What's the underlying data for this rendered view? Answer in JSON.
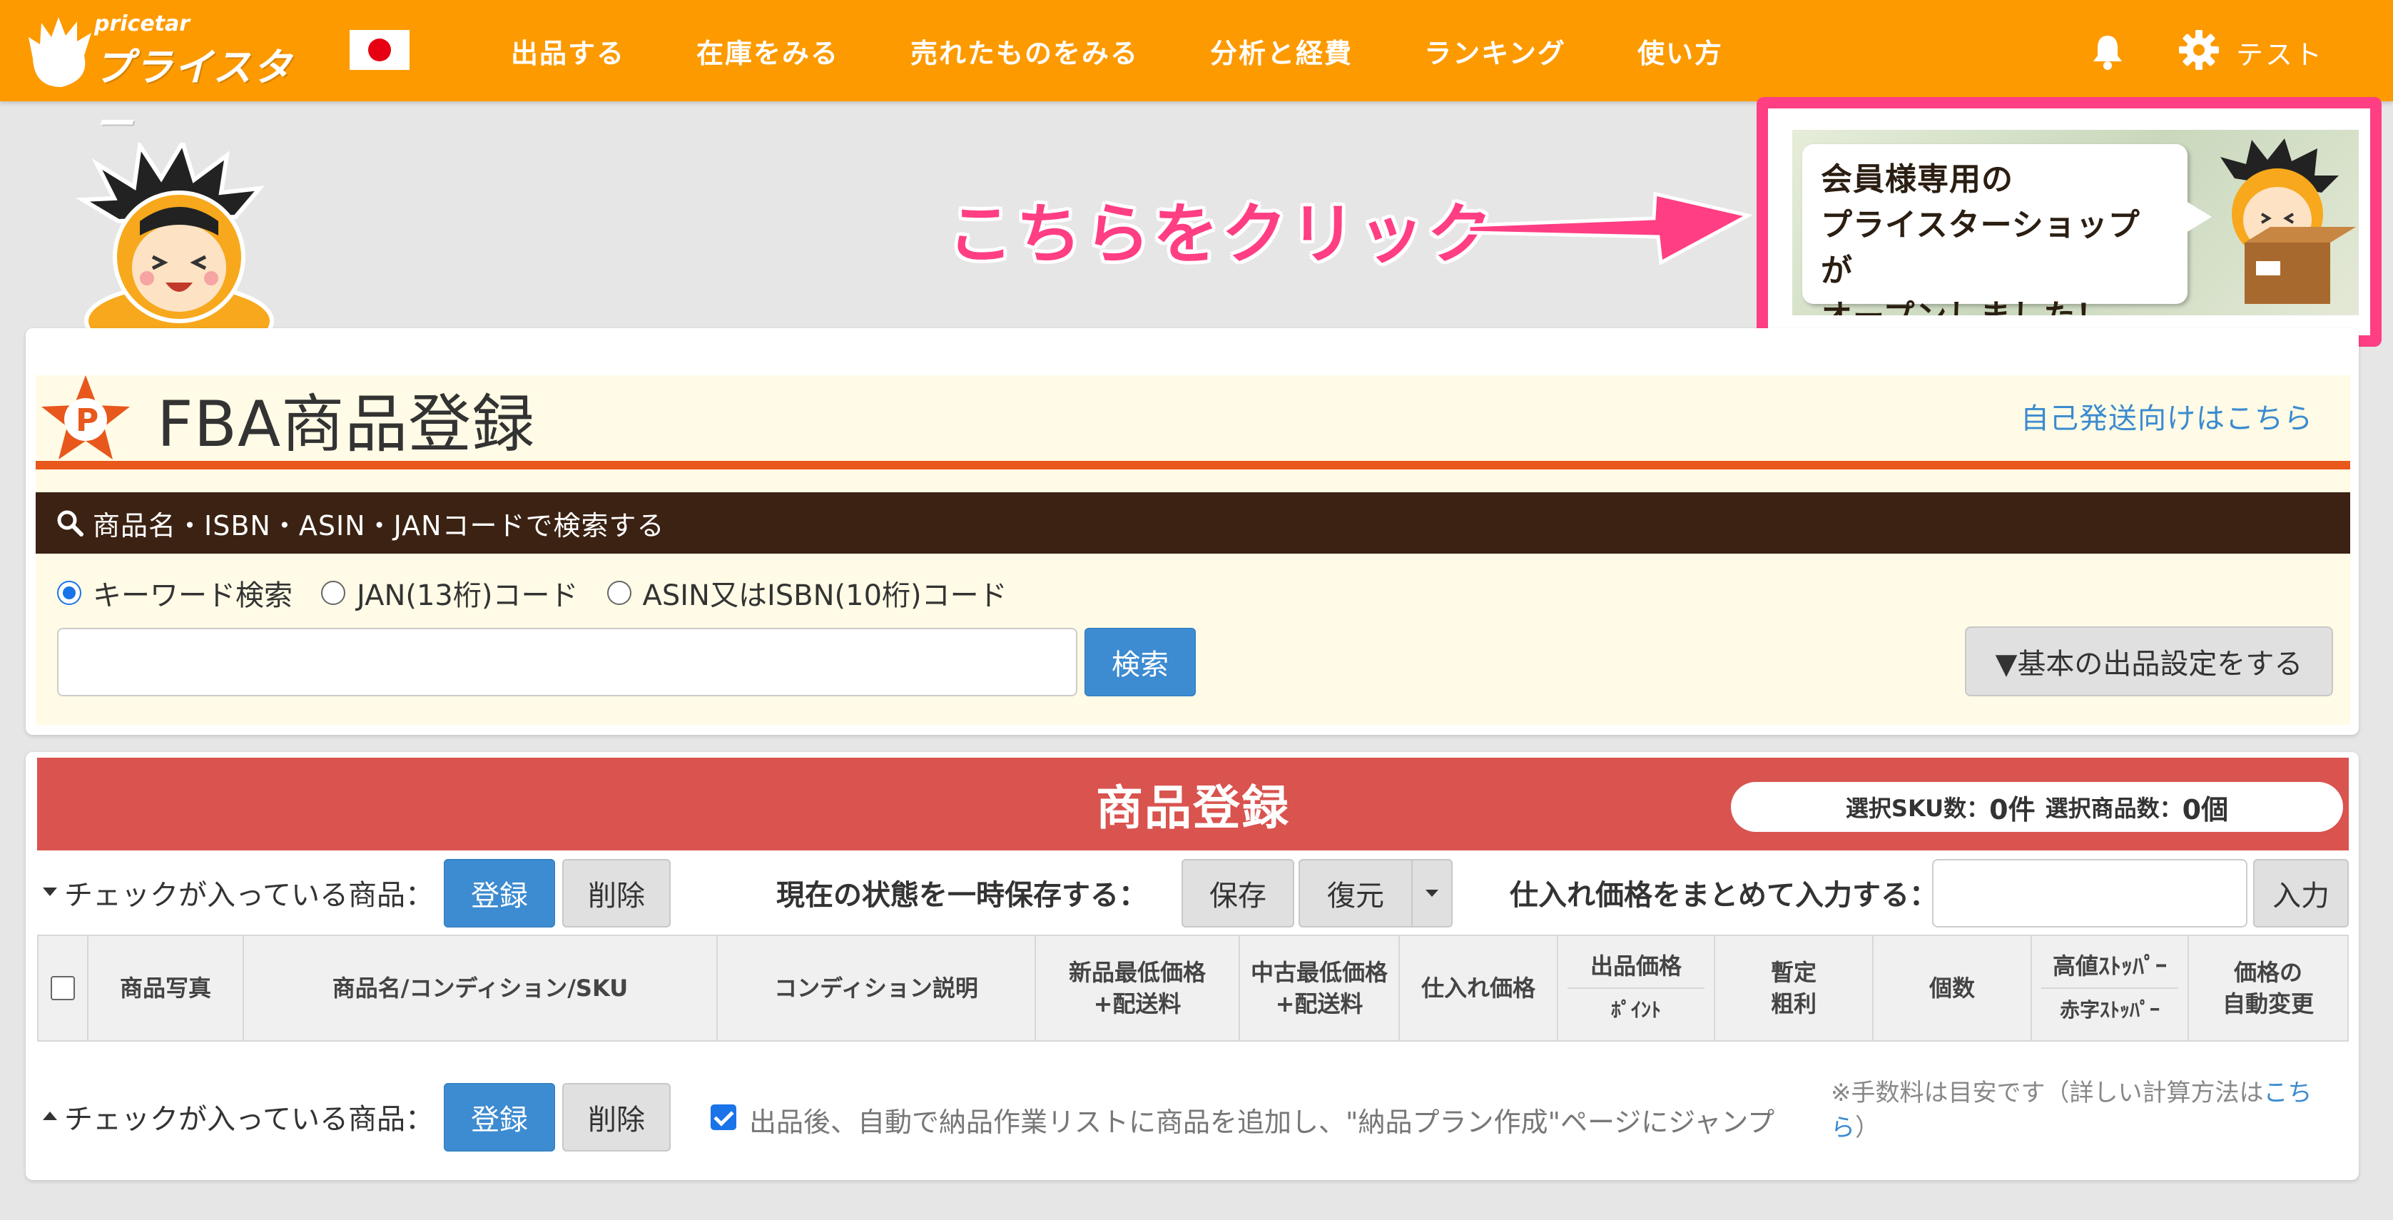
{
  "header": {
    "logo_small": "pricetar",
    "logo_big": "プライスター",
    "nav": [
      "出品する",
      "在庫をみる",
      "売れたものをみる",
      "分析と経費",
      "ランキング",
      "使い方"
    ],
    "user_name": "テスト",
    "colors": {
      "bar": "#fd9a00"
    }
  },
  "annotation": {
    "text": "こちらをクリック",
    "color": "#ff3e84"
  },
  "banner": {
    "lines": [
      "会員様専用の",
      "プライスターショップが",
      "オープンしました！"
    ]
  },
  "fba": {
    "title": "FBA商品登録",
    "self_ship_link": "自己発送向けはこちら",
    "search_bar_label": "商品名・ISBN・ASIN・JANコードで検索する",
    "radios": [
      {
        "label": "キーワード検索",
        "checked": true
      },
      {
        "label": "JAN(13桁)コード",
        "checked": false
      },
      {
        "label": "ASIN又はISBN(10桁)コード",
        "checked": false
      }
    ],
    "search_value": "",
    "search_button": "検索",
    "default_settings_button": "▼基本の出品設定をする"
  },
  "registration": {
    "title": "商品登録",
    "count_sku_label": "選択SKU数：",
    "count_sku_value": "0件",
    "count_items_label": "選択商品数：",
    "count_items_value": "0個",
    "checked_label_top": "チェックが入っている商品：",
    "checked_label_bottom": "チェックが入っている商品：",
    "register_button": "登録",
    "delete_button": "削除",
    "save_state_label": "現在の状態を一時保存する：",
    "save_button": "保存",
    "restore_button": "復元",
    "bulk_price_label": "仕入れ価格をまとめて入力する：",
    "bulk_price_value": "",
    "input_button": "入力",
    "columns": [
      {
        "label": "商品写真"
      },
      {
        "label": "商品名/コンディション/SKU"
      },
      {
        "label": "コンディション説明"
      },
      {
        "label": "新品最低価格",
        "label2": "+配送料"
      },
      {
        "label": "中古最低価格",
        "label2": "+配送料"
      },
      {
        "label": "仕入れ価格"
      },
      {
        "label": "出品価格",
        "sub": "ﾎﾟｲﾝﾄ"
      },
      {
        "label": "暫定",
        "label2": "粗利"
      },
      {
        "label": "個数"
      },
      {
        "label": "高値ｽﾄｯﾊﾟｰ",
        "sub": "赤字ｽﾄｯﾊﾟｰ"
      },
      {
        "label": "価格の",
        "label2": "自動変更"
      }
    ],
    "auto_add_label": "出品後、自動で納品作業リストに商品を追加し、\"納品プラン作成\"ページにジャンプ",
    "auto_add_checked": true,
    "fee_note_prefix": "※手数料は目安です（詳しい計算方法は",
    "fee_note_link": "こちら",
    "fee_note_suffix": "）"
  }
}
